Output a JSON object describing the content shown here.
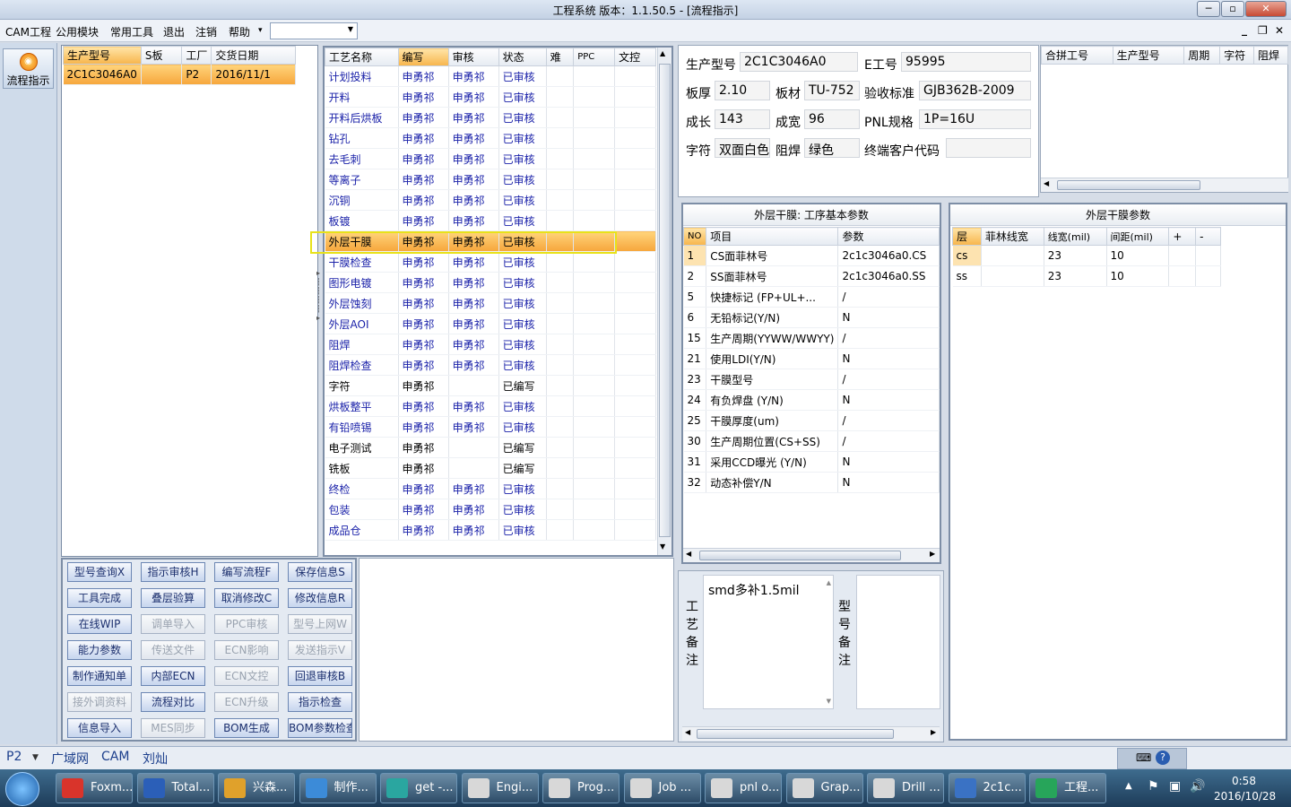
{
  "window": {
    "title": "工程系统    版本：1.1.50.5 - [流程指示]",
    "min": "─",
    "max": "▫",
    "close": "✕"
  },
  "menu": {
    "items": [
      "CAM工程",
      "公用模块",
      "常用工具",
      "退出",
      "注销",
      "帮助"
    ],
    "help_arrow": "▾",
    "mdi_min": "_",
    "mdi_restore": "❐",
    "mdi_close": "✕"
  },
  "leftbar": {
    "flow_button": "流程指示"
  },
  "orders": {
    "headers": [
      "生产型号",
      "S板",
      "工厂",
      "交货日期"
    ],
    "rows": [
      {
        "model": "2C1C3046A0",
        "s": "",
        "factory": "P2",
        "date": "2016/11/1"
      }
    ]
  },
  "process": {
    "headers": [
      "工艺名称",
      "编写",
      "审核",
      "状态",
      "难",
      "PPC",
      "文控"
    ],
    "rows": [
      [
        "计划投料",
        "申勇祁",
        "申勇祁",
        "已审核"
      ],
      [
        "开料",
        "申勇祁",
        "申勇祁",
        "已审核"
      ],
      [
        "开料后烘板",
        "申勇祁",
        "申勇祁",
        "已审核"
      ],
      [
        "钻孔",
        "申勇祁",
        "申勇祁",
        "已审核"
      ],
      [
        "去毛刺",
        "申勇祁",
        "申勇祁",
        "已审核"
      ],
      [
        "等离子",
        "申勇祁",
        "申勇祁",
        "已审核"
      ],
      [
        "沉铜",
        "申勇祁",
        "申勇祁",
        "已审核"
      ],
      [
        "板镀",
        "申勇祁",
        "申勇祁",
        "已审核"
      ],
      [
        "外层干膜",
        "申勇祁",
        "申勇祁",
        "已审核"
      ],
      [
        "干膜检查",
        "申勇祁",
        "申勇祁",
        "已审核"
      ],
      [
        "图形电镀",
        "申勇祁",
        "申勇祁",
        "已审核"
      ],
      [
        "外层蚀刻",
        "申勇祁",
        "申勇祁",
        "已审核"
      ],
      [
        "外层AOI",
        "申勇祁",
        "申勇祁",
        "已审核"
      ],
      [
        "阻焊",
        "申勇祁",
        "申勇祁",
        "已审核"
      ],
      [
        "阻焊检查",
        "申勇祁",
        "申勇祁",
        "已审核"
      ],
      [
        "字符",
        "申勇祁",
        "",
        "已编写"
      ],
      [
        "烘板整平",
        "申勇祁",
        "申勇祁",
        "已审核"
      ],
      [
        "有铅喷锡",
        "申勇祁",
        "申勇祁",
        "已审核"
      ],
      [
        "电子测试",
        "申勇祁",
        "",
        "已编写"
      ],
      [
        "铣板",
        "申勇祁",
        "",
        "已编写"
      ],
      [
        "终检",
        "申勇祁",
        "申勇祁",
        "已审核"
      ],
      [
        "包装",
        "申勇祁",
        "申勇祁",
        "已审核"
      ],
      [
        "成品仓",
        "申勇祁",
        "申勇祁",
        "已审核"
      ]
    ],
    "selected_row": 8
  },
  "info": {
    "model_label": "生产型号",
    "model": "2C1C3046A0",
    "e_label": "E工号",
    "e_no": "95995",
    "thick_label": "板厚",
    "thick": "2.10",
    "material_label": "板材",
    "material": "TU-752",
    "std_label": "验收标准",
    "std": "GJB362B-2009",
    "len_label": "成长",
    "len": "143",
    "width_label": "成宽",
    "width": "96",
    "pnl_label": "PNL规格",
    "pnl": "1P=16U",
    "char_label": "字符",
    "char": "双面白色",
    "mask_label": "阻焊",
    "mask": "绿色",
    "cust_label": "终端客户代码",
    "cust": ""
  },
  "merge": {
    "headers": [
      "合拼工号",
      "生产型号",
      "周期",
      "字符",
      "阻焊"
    ]
  },
  "params": {
    "title": "外层干膜: 工序基本参数",
    "headers": [
      "NO",
      "项目",
      "参数"
    ],
    "rows": [
      [
        "1",
        "CS面菲林号",
        "2c1c3046a0.CS"
      ],
      [
        "2",
        "SS面菲林号",
        "2c1c3046a0.SS"
      ],
      [
        "5",
        "快捷标记 (FP+UL+...",
        "/"
      ],
      [
        "6",
        "无铅标记(Y/N)",
        "N"
      ],
      [
        "15",
        "生产周期(YYWW/WWYY)",
        "/"
      ],
      [
        "21",
        "使用LDI(Y/N)",
        "N"
      ],
      [
        "23",
        "干膜型号",
        "/"
      ],
      [
        "24",
        "有负焊盘 (Y/N)",
        "N"
      ],
      [
        "25",
        "干膜厚度(um)",
        "/"
      ],
      [
        "30",
        "生产周期位置(CS+SS)",
        "/"
      ],
      [
        "31",
        "采用CCD曝光 (Y/N)",
        "N"
      ],
      [
        "32",
        "动态补偿Y/N",
        "N"
      ]
    ]
  },
  "outer": {
    "title": "外层干膜参数",
    "headers": [
      "层",
      "菲林线宽",
      "线宽(mil)",
      "间距(mil)",
      "+",
      "-"
    ],
    "rows": [
      [
        "cs",
        "",
        "23",
        "10"
      ],
      [
        "ss",
        "",
        "23",
        "10"
      ]
    ]
  },
  "notes": {
    "process_label": "工艺备注",
    "process_text": "smd多补1.5mil",
    "model_label": "型号备注",
    "model_text": ""
  },
  "buttons": [
    {
      "label": "型号查询X",
      "enabled": true
    },
    {
      "label": "指示审核H",
      "enabled": true
    },
    {
      "label": "编写流程F",
      "enabled": true
    },
    {
      "label": "保存信息S",
      "enabled": true
    },
    {
      "label": "工具完成",
      "enabled": true
    },
    {
      "label": "叠层验算",
      "enabled": true
    },
    {
      "label": "取消修改C",
      "enabled": true
    },
    {
      "label": "修改信息R",
      "enabled": true
    },
    {
      "label": "在线WIP",
      "enabled": true
    },
    {
      "label": "调单导入",
      "enabled": false
    },
    {
      "label": "PPC审核",
      "enabled": false
    },
    {
      "label": "型号上网W",
      "enabled": false
    },
    {
      "label": "能力参数",
      "enabled": true
    },
    {
      "label": "传送文件",
      "enabled": false
    },
    {
      "label": "ECN影响",
      "enabled": false
    },
    {
      "label": "发送指示V",
      "enabled": false
    },
    {
      "label": "制作通知单",
      "enabled": true
    },
    {
      "label": "内部ECN",
      "enabled": true
    },
    {
      "label": "ECN文控",
      "enabled": false
    },
    {
      "label": "回退审核B",
      "enabled": true
    },
    {
      "label": "接外调资料",
      "enabled": false
    },
    {
      "label": "流程对比",
      "enabled": true
    },
    {
      "label": "ECN升级",
      "enabled": false
    },
    {
      "label": "指示检查",
      "enabled": true
    },
    {
      "label": "信息导入",
      "enabled": true
    },
    {
      "label": "MES同步",
      "enabled": false
    },
    {
      "label": "BOM生成",
      "enabled": true
    },
    {
      "label": "BOM参数检查",
      "enabled": true
    }
  ],
  "status": {
    "site": "P2",
    "net": "广域网",
    "app": "CAM",
    "user": "刘灿"
  },
  "taskbar": {
    "items": [
      "Foxm...",
      "Total...",
      "兴森...",
      "制作...",
      "get -...",
      "Engi...",
      "Prog...",
      "Job ...",
      "pnl o...",
      "Grap...",
      "Drill ...",
      "2c1c...",
      "工程..."
    ],
    "time": "0:58",
    "date": "2016/10/28"
  },
  "colors": {
    "selected": "#f6a63b",
    "link_blue": "#1b22a9",
    "highlight_border": "#e8e21a"
  }
}
